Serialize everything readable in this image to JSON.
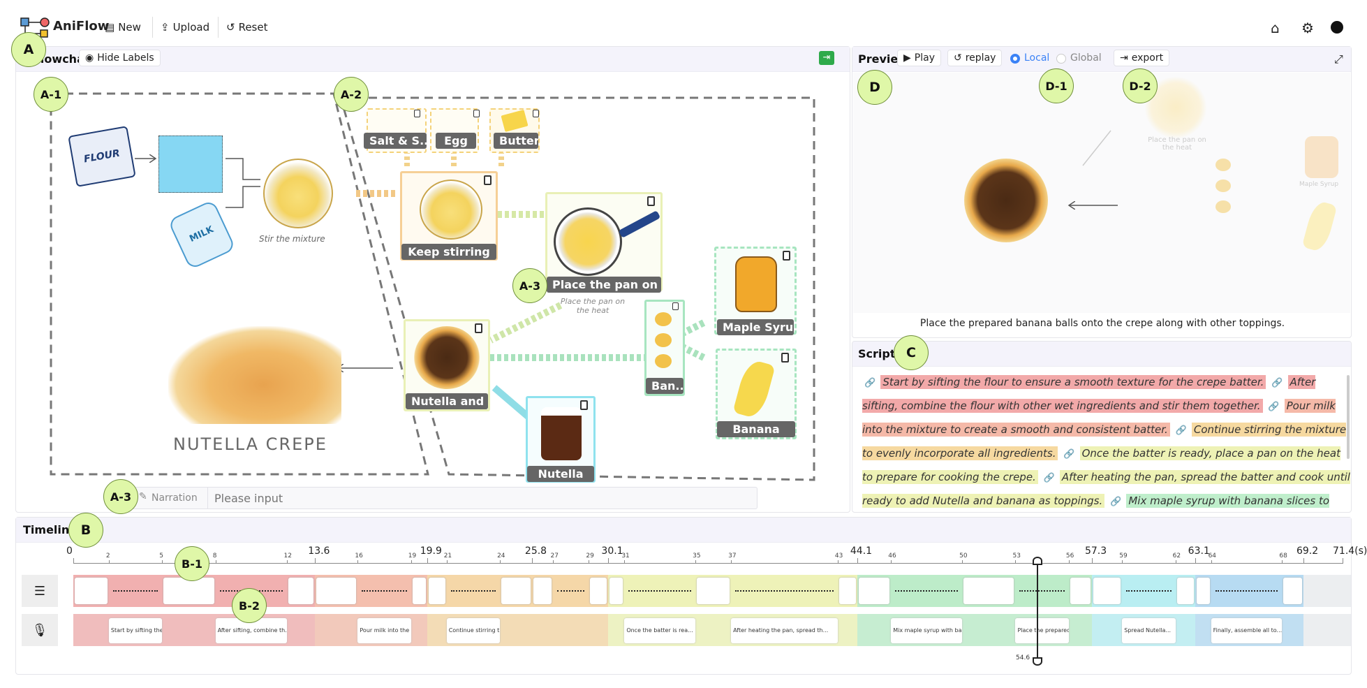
{
  "app": {
    "name": "AniFlow",
    "new_label": "New",
    "upload_label": "Upload",
    "reset_label": "Reset"
  },
  "annotations": {
    "a": "A",
    "a1": "A-1",
    "a2": "A-2",
    "a3": "A-3",
    "a3b": "A-3",
    "b": "B",
    "b1": "B-1",
    "b2": "B-2",
    "c": "C",
    "d": "D",
    "d1": "D-1",
    "d2": "D-2"
  },
  "flowchart": {
    "title": "Flowchart",
    "hide_labels": "Hide Labels",
    "caption_stir": "Stir the mixture",
    "caption_crepe": "NUTELLA CREPE",
    "caption_pan": "Place the pan on the heat",
    "nodes": {
      "salt": "Salt & S...",
      "egg": "Egg",
      "butter": "Butter",
      "keep": "Keep stirring",
      "pan": "Place the pan on t...",
      "maple": "Maple Syrup",
      "banana_balls": "Ban...",
      "banana": "Banana",
      "nutella_and": "Nutella and ...",
      "nutella": "Nutella"
    },
    "narration_label": "Narration",
    "narration_placeholder": "Please input"
  },
  "preview": {
    "title": "Preview",
    "play": "Play",
    "replay": "replay",
    "local": "Local",
    "global": "Global",
    "export": "export",
    "caption": "Place the prepared banana balls onto the crepe along with other toppings.",
    "faded_pan": "Place the pan on the heat",
    "faded_syrup": "Maple Syrup"
  },
  "script": {
    "title": "Script",
    "segments": [
      {
        "text": "Start by sifting the flour to ensure a smooth texture for the crepe batter.",
        "color": "#f2a9a9"
      },
      {
        "text": "After sifting, combine the flour with other wet ingredients and stir them together.",
        "color": "#f2a9a9"
      },
      {
        "text": "Pour milk into the mixture to create a smooth and consistent batter.",
        "color": "#f5b9a8"
      },
      {
        "text": "Continue stirring the mixture to evenly incorporate all ingredients.",
        "color": "#f6d9a0"
      },
      {
        "text": "Once the batter is ready, place a pan on the heat to prepare for cooking the crepe.",
        "color": "#eef2b5"
      },
      {
        "text": "After heating the pan, spread the batter and cook until ready to add Nutella and banana as toppings.",
        "color": "#eef2b5"
      },
      {
        "text": "Mix maple syrup with banana slices to form sweet banana balls.",
        "color": "#bfeecb"
      }
    ]
  },
  "timeline": {
    "title": "Timeline",
    "unit": "(s)",
    "big_ticks": [
      "0",
      "13.6",
      "19.9",
      "25.8",
      "30.1",
      "44.1",
      "57.3",
      "63.1",
      "69.2",
      "71.4(s)"
    ],
    "small_ticks": [
      "2",
      "5",
      "8",
      "12",
      "16",
      "19",
      "21",
      "24",
      "27",
      "29",
      "31",
      "35",
      "37",
      "43",
      "46",
      "50",
      "53",
      "56",
      "59",
      "62",
      "64",
      "68"
    ],
    "playhead": "54.6",
    "narrations": [
      "Start by sifting the fl...",
      "After sifting, combine th...",
      "Pour milk into the ...",
      "Continue stirring th...",
      "Once the batter is rea...",
      "After heating the pan, spread th...",
      "Mix maple syrup with ba...",
      "Place the prepared...",
      "Spread Nutella...",
      "Finally, assemble all to..."
    ],
    "colors": {
      "red": "#f1b0b0",
      "salmon": "#f4bfae",
      "orange": "#f5d7a8",
      "yellow": "#eef2b8",
      "green": "#bdecc9",
      "cyan": "#b9eef2",
      "blue": "#b7dbf2"
    }
  }
}
